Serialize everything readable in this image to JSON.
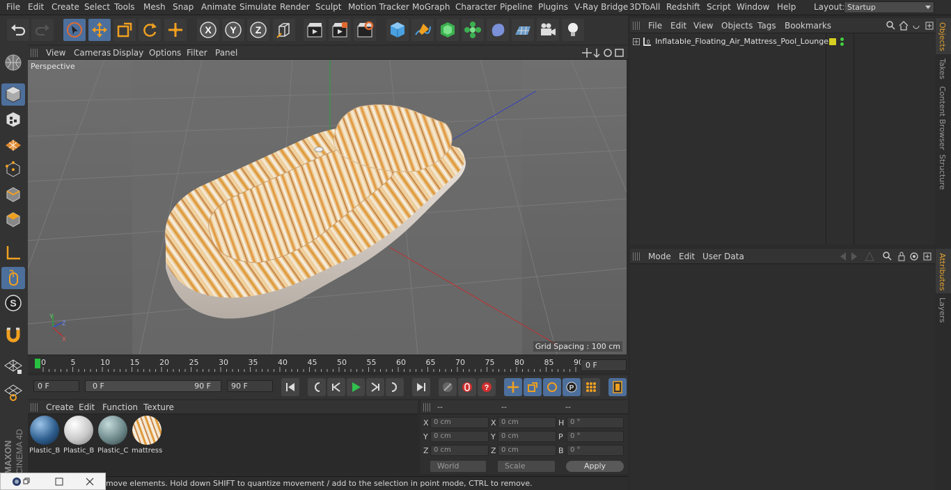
{
  "menu": {
    "items": [
      "File",
      "Edit",
      "Create",
      "Select",
      "Tools",
      "Mesh",
      "Snap",
      "Animate",
      "Simulate",
      "Render",
      "Sculpt",
      "Motion Tracker",
      "MoGraph",
      "Character",
      "Pipeline",
      "Plugins",
      "V-Ray Bridge",
      "3DToAll",
      "Redshift",
      "Script",
      "Window",
      "Help"
    ],
    "layout_label": "Layout:",
    "layout_value": "Startup"
  },
  "toolbar": {
    "icons": [
      "undo-icon",
      "redo-icon",
      "select-icon",
      "move-icon",
      "scale-icon",
      "rotate-icon",
      "live-select-icon",
      "x-axis-icon",
      "y-axis-icon",
      "z-axis-icon",
      "world-coords-icon",
      "render-view-icon",
      "render-active-icon",
      "render-settings-icon",
      "cube-icon",
      "pen-icon",
      "subdivision-icon",
      "cloner-icon",
      "deformer-icon",
      "floor-icon",
      "camera-icon",
      "light-icon"
    ],
    "axis": {
      "x": "X",
      "y": "Y",
      "z": "Z"
    }
  },
  "viewport": {
    "menu": [
      "View",
      "Cameras",
      "Display",
      "Options",
      "Filter",
      "Panel"
    ],
    "camera_name": "Perspective",
    "grid_spacing": "Grid Spacing : 100 cm"
  },
  "timeline": {
    "ticks": [
      "0",
      "5",
      "10",
      "15",
      "20",
      "25",
      "30",
      "35",
      "40",
      "45",
      "50",
      "55",
      "60",
      "65",
      "70",
      "75",
      "80",
      "85",
      "90"
    ],
    "current_frame": "0 F"
  },
  "transport": {
    "start_frame": "0 F",
    "range_start": "0 F",
    "range_end": "90 F",
    "end_frame": "90 F"
  },
  "materials": {
    "menu": [
      "Create",
      "Edit",
      "Function",
      "Texture"
    ],
    "items": [
      {
        "label": "Plastic_B",
        "color": "#2f5f8f"
      },
      {
        "label": "Plastic_B",
        "color": "#c9c9c9"
      },
      {
        "label": "Plastic_C",
        "color": "#6f8a8c"
      },
      {
        "label": "mattress",
        "color": "#d8a46a"
      }
    ]
  },
  "coordinates": {
    "headers": [
      "--",
      "--",
      "--"
    ],
    "rows": [
      {
        "a": "X",
        "av": "0 cm",
        "b": "X",
        "bv": "0 cm",
        "c": "H",
        "cv": "0 °"
      },
      {
        "a": "Y",
        "av": "0 cm",
        "b": "Y",
        "bv": "0 cm",
        "c": "P",
        "cv": "0 °"
      },
      {
        "a": "Z",
        "av": "0 cm",
        "b": "Z",
        "bv": "0 cm",
        "c": "B",
        "cv": "0 °"
      }
    ],
    "space": "World",
    "mode": "Scale",
    "apply": "Apply"
  },
  "objects": {
    "menu": [
      "File",
      "Edit",
      "View",
      "Objects",
      "Tags",
      "Bookmarks"
    ],
    "items": [
      {
        "name": "Inflatable_Floating_Air_Mattress_Pool_Lounger",
        "tag_color": "#d8d020"
      }
    ]
  },
  "attributes": {
    "menu": [
      "Mode",
      "Edit",
      "User Data"
    ]
  },
  "right_tabs": [
    "Objects",
    "Takes",
    "Content Browser",
    "Structure",
    "Attributes",
    "Layers"
  ],
  "status": "move elements. Hold down SHIFT to quantize movement / add to the selection in point mode, CTRL to remove.",
  "brand": "MAXON CINEMA 4D"
}
